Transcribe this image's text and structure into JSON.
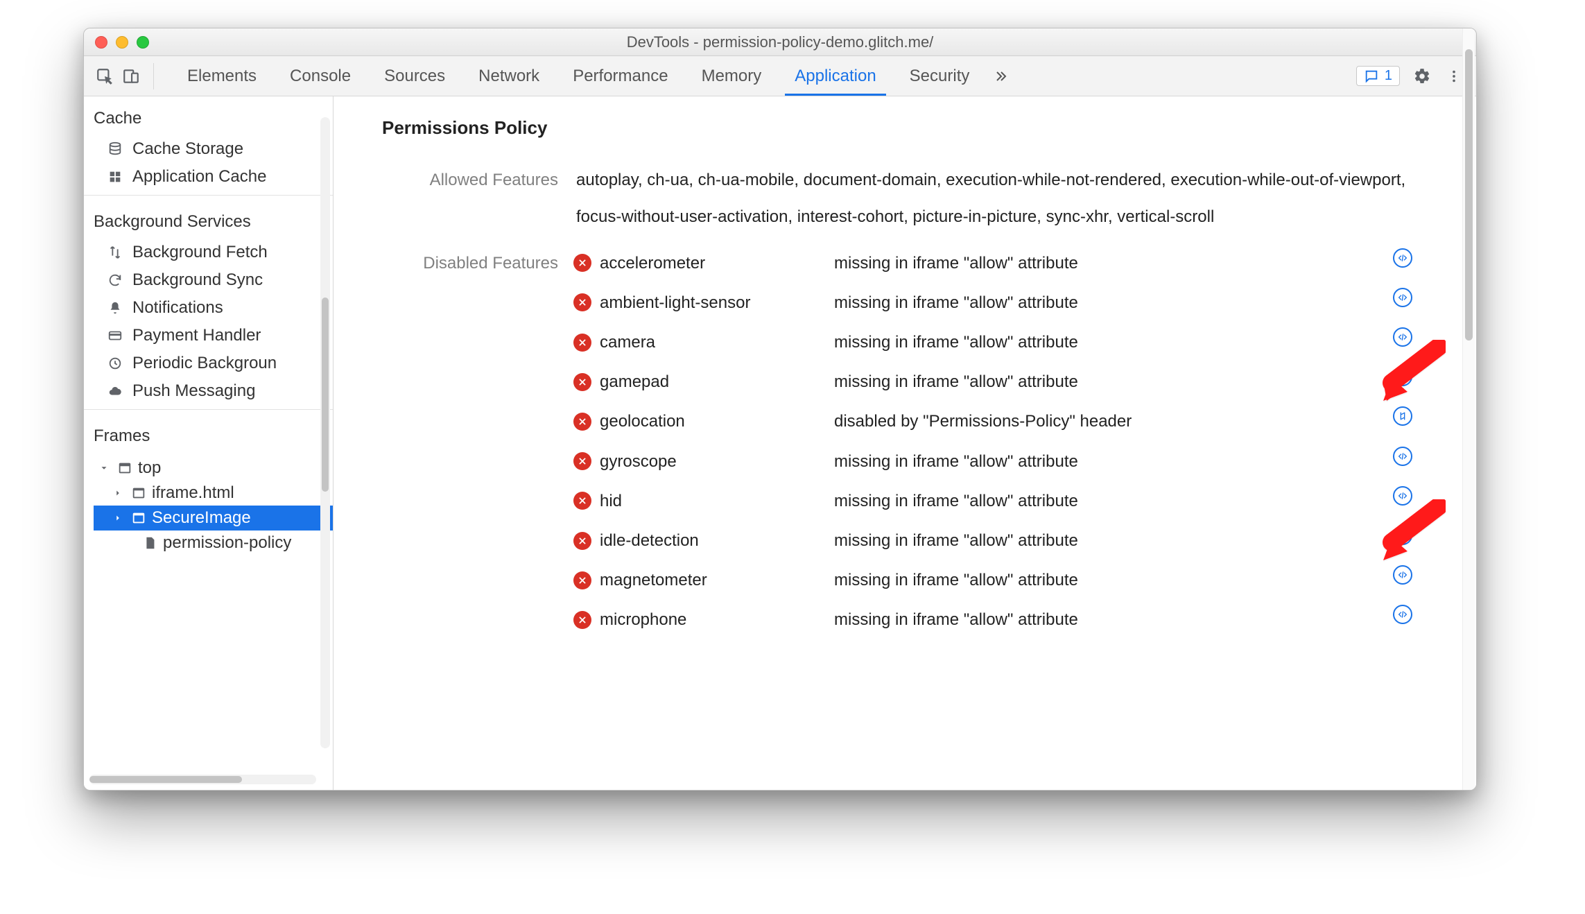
{
  "window": {
    "title": "DevTools - permission-policy-demo.glitch.me/"
  },
  "tabs": {
    "items": [
      "Elements",
      "Console",
      "Sources",
      "Network",
      "Performance",
      "Memory",
      "Application",
      "Security"
    ],
    "active_index": 6,
    "issues_count": "1"
  },
  "sidebar": {
    "sections": [
      {
        "title": "Cache",
        "items": [
          {
            "icon": "database-icon",
            "label": "Cache Storage"
          },
          {
            "icon": "grid-icon",
            "label": "Application Cache"
          }
        ]
      },
      {
        "title": "Background Services",
        "items": [
          {
            "icon": "updown-icon",
            "label": "Background Fetch"
          },
          {
            "icon": "sync-icon",
            "label": "Background Sync"
          },
          {
            "icon": "bell-icon",
            "label": "Notifications"
          },
          {
            "icon": "card-icon",
            "label": "Payment Handler"
          },
          {
            "icon": "clock-icon",
            "label": "Periodic Backgroun"
          },
          {
            "icon": "cloud-icon",
            "label": "Push Messaging"
          }
        ]
      },
      {
        "title": "Frames",
        "tree": [
          {
            "level": 1,
            "icon": "frame-icon",
            "label": "top",
            "caret": "down"
          },
          {
            "level": 2,
            "icon": "iframe-icon",
            "label": "iframe.html",
            "caret": "right"
          },
          {
            "level": 2,
            "icon": "iframe-icon",
            "label": "SecureImage",
            "caret": "right",
            "selected": true
          },
          {
            "level": 3,
            "icon": "document-icon",
            "label": "permission-policy"
          }
        ]
      }
    ]
  },
  "main": {
    "title": "Permissions Policy",
    "allowed_label": "Allowed Features",
    "allowed_value": "autoplay, ch-ua, ch-ua-mobile, document-domain, execution-while-not-rendered, execution-while-out-of-viewport, focus-without-user-activation, interest-cohort, picture-in-picture, sync-xhr, vertical-scroll",
    "disabled_label": "Disabled Features",
    "disabled": [
      {
        "name": "accelerometer",
        "reason": "missing in iframe \"allow\" attribute",
        "link": "code"
      },
      {
        "name": "ambient-light-sensor",
        "reason": "missing in iframe \"allow\" attribute",
        "link": "code"
      },
      {
        "name": "camera",
        "reason": "missing in iframe \"allow\" attribute",
        "link": "code"
      },
      {
        "name": "gamepad",
        "reason": "missing in iframe \"allow\" attribute",
        "link": "code"
      },
      {
        "name": "geolocation",
        "reason": "disabled by \"Permissions-Policy\" header",
        "link": "network"
      },
      {
        "name": "gyroscope",
        "reason": "missing in iframe \"allow\" attribute",
        "link": "code"
      },
      {
        "name": "hid",
        "reason": "missing in iframe \"allow\" attribute",
        "link": "code"
      },
      {
        "name": "idle-detection",
        "reason": "missing in iframe \"allow\" attribute",
        "link": "code"
      },
      {
        "name": "magnetometer",
        "reason": "missing in iframe \"allow\" attribute",
        "link": "code"
      },
      {
        "name": "microphone",
        "reason": "missing in iframe \"allow\" attribute",
        "link": "code"
      }
    ]
  }
}
